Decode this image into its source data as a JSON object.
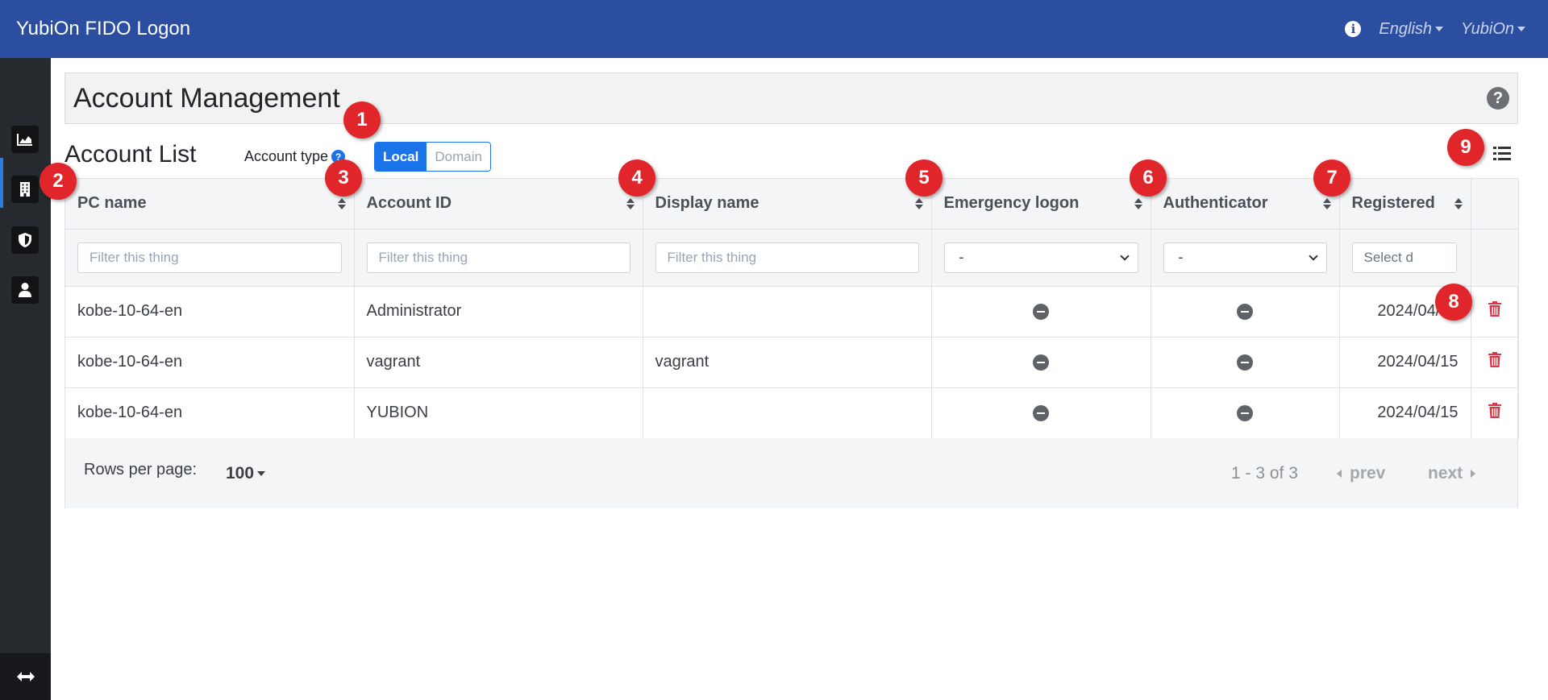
{
  "app": {
    "title": "YubiOn FIDO Logon"
  },
  "topbar": {
    "language": "English",
    "user": "YubiOn"
  },
  "page": {
    "title": "Account Management"
  },
  "list": {
    "title": "Account List",
    "account_type_label": "Account type",
    "toggle": {
      "local": "Local",
      "domain": "Domain",
      "selected": "Local"
    }
  },
  "table": {
    "columns": [
      "PC name",
      "Account ID",
      "Display name",
      "Emergency logon",
      "Authenticator",
      "Registered"
    ],
    "filters": {
      "placeholder": "Filter this thing",
      "select_value": "-",
      "date_placeholder": "Select d"
    },
    "rows": [
      {
        "pc": "kobe-10-64-en",
        "account_id": "Administrator",
        "display_name": "",
        "registered": "2024/04/15"
      },
      {
        "pc": "kobe-10-64-en",
        "account_id": "vagrant",
        "display_name": "vagrant",
        "registered": "2024/04/15"
      },
      {
        "pc": "kobe-10-64-en",
        "account_id": "YUBION",
        "display_name": "",
        "registered": "2024/04/15"
      }
    ]
  },
  "pagination": {
    "rows_per_page_label": "Rows per page:",
    "rows_per_page": "100",
    "range": "1 - 3 of 3",
    "prev": "prev",
    "next": "next"
  },
  "callouts": [
    "1",
    "2",
    "3",
    "4",
    "5",
    "6",
    "7",
    "8",
    "9"
  ],
  "colors": {
    "topbar": "#2b4ea1",
    "accent": "#1a73e8",
    "danger": "#dc3545",
    "callout": "#e0262b"
  }
}
